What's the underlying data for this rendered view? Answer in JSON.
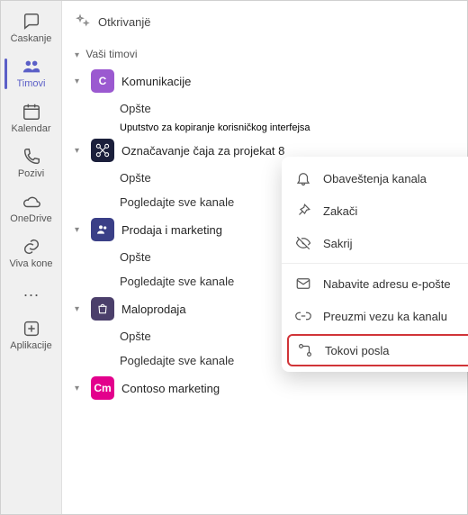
{
  "rail": {
    "items": [
      {
        "key": "chat",
        "label": "Ćaskanje",
        "icon": "chat-icon"
      },
      {
        "key": "teams",
        "label": "Timovi",
        "icon": "people-icon",
        "active": true
      },
      {
        "key": "calendar",
        "label": "Kalendar",
        "icon": "calendar-icon"
      },
      {
        "key": "calls",
        "label": "Pozivi",
        "icon": "phone-icon"
      },
      {
        "key": "onedrive",
        "label": "OneDrive",
        "icon": "cloud-icon"
      },
      {
        "key": "viva",
        "label": "Viva kone",
        "icon": "link-icon"
      }
    ],
    "more_label": "···",
    "apps_label": "Aplikacije"
  },
  "discover_label": "Otkrivanjë",
  "section_label": "Vaši timovi",
  "teams": [
    {
      "avatar_letter": "C",
      "avatar_bg": "#9b59d0",
      "name": "Komunikacije",
      "channels": [
        {
          "label": "Opšte"
        },
        {
          "label": "Uputstvo za kopiranje korisničkog interfejsa",
          "sub": true,
          "selected": true
        }
      ]
    },
    {
      "avatar_letter": "",
      "avatar_bg": "#1b1f3b",
      "avatar_icon": "drone",
      "name": "Označavanje čaja za projekat 8",
      "channels": [
        {
          "label": "Opšte"
        },
        {
          "label": "Pogledajte sve kanale"
        }
      ]
    },
    {
      "avatar_letter": "",
      "avatar_bg": "#3a3f87",
      "avatar_icon": "people",
      "name": "Prodaja i marketing",
      "channels": [
        {
          "label": "Opšte"
        },
        {
          "label": "Pogledajte sve kanale"
        }
      ]
    },
    {
      "avatar_letter": "",
      "avatar_bg": "#4b3f6b",
      "avatar_icon": "bag",
      "name": "Maloprodaja",
      "channels": [
        {
          "label": "Opšte"
        },
        {
          "label": "Pogledajte sve kanale"
        }
      ]
    },
    {
      "avatar_letter": "Cm",
      "avatar_bg": "#e3008c",
      "name": "Contoso marketing",
      "channels": []
    }
  ],
  "context_menu": {
    "items": [
      {
        "icon": "bell-icon",
        "label": "Obaveštenja kanala"
      },
      {
        "icon": "pin-icon",
        "label": "Zakači"
      },
      {
        "icon": "eye-off-icon",
        "label": "Sakrij"
      },
      {
        "divider": true
      },
      {
        "icon": "mail-icon",
        "label": "Nabavite adresu e-pošte"
      },
      {
        "icon": "link2-icon",
        "label": "Preuzmi vezu ka kanalu"
      },
      {
        "icon": "flow-icon",
        "label": "Tokovi posla",
        "highlight": true
      }
    ]
  }
}
